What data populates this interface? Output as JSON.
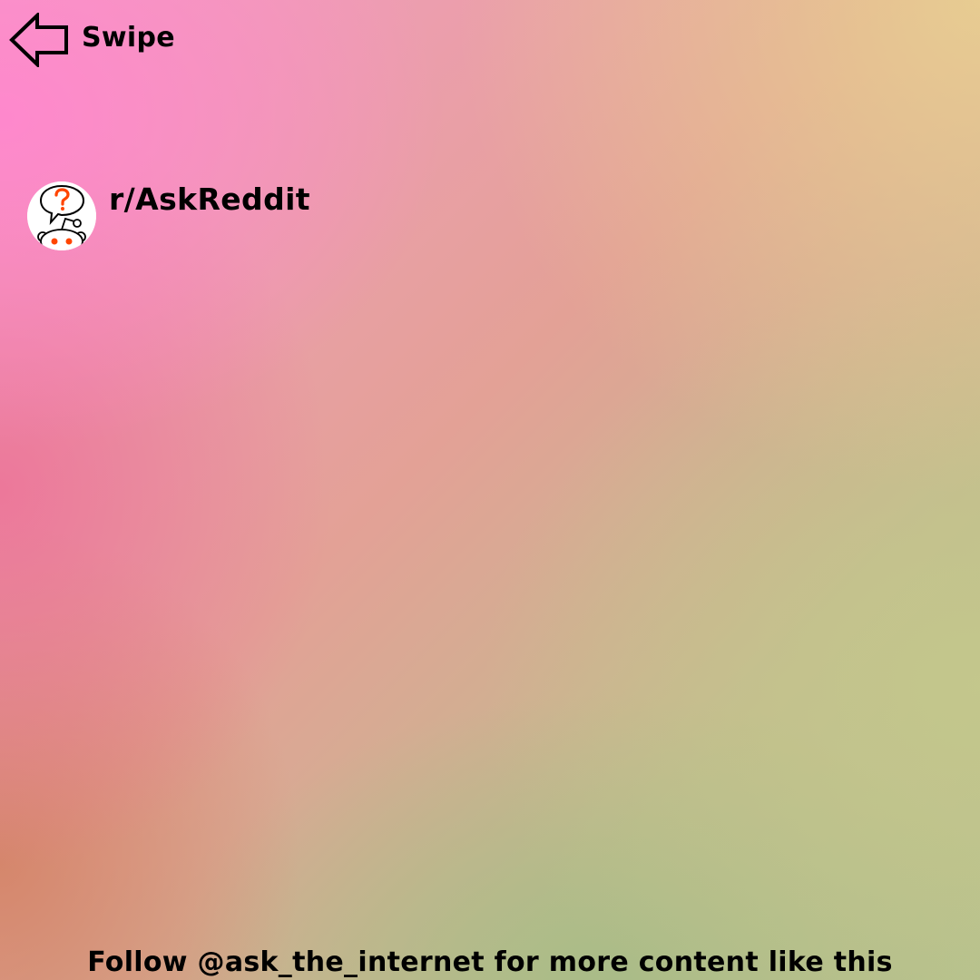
{
  "swipe": {
    "label": "Swipe",
    "icon": "arrow-left-icon"
  },
  "subreddit": {
    "name": "r/AskReddit",
    "icon": "askreddit-avatar-icon",
    "accent_color": "#ff4500"
  },
  "footer": {
    "text": "Follow @ask_the_internet for more content like this"
  },
  "colors": {
    "text": "#000000",
    "gradient_pink": "#ff87cd",
    "gradient_peach": "#e8ce91",
    "gradient_green": "#a8bc87"
  }
}
